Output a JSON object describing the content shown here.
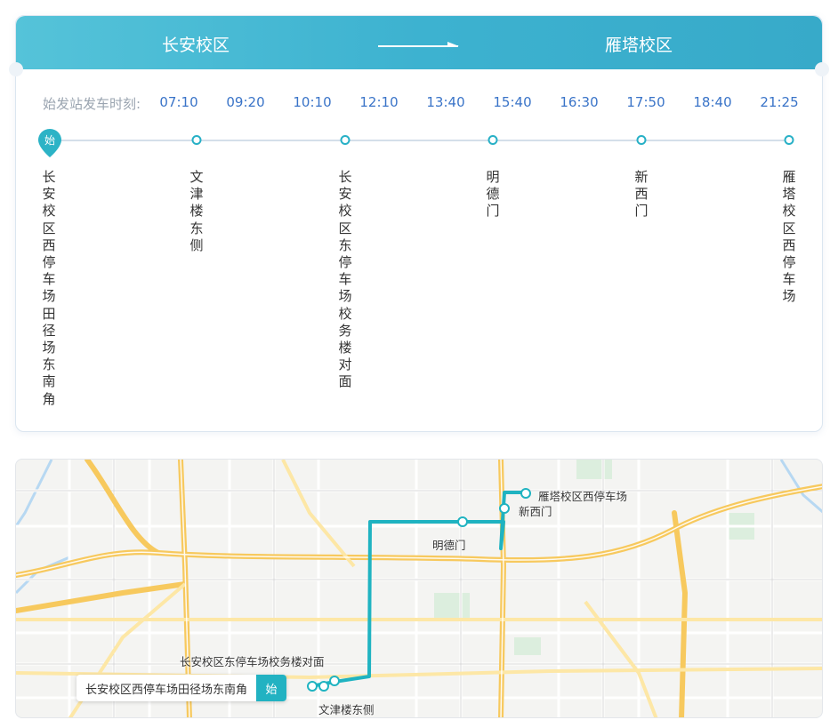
{
  "header": {
    "from_campus": "长安校区",
    "to_campus": "雁塔校区"
  },
  "schedule": {
    "label": "始发站发车时刻:",
    "times": [
      "07:10",
      "09:20",
      "10:10",
      "12:10",
      "13:40",
      "15:40",
      "16:30",
      "17:50",
      "18:40",
      "21:25"
    ]
  },
  "route": {
    "start_tag": "始",
    "stops": [
      "长安校区西停车场田径场东南角",
      "文津楼东侧",
      "长安校区东停车场校务楼对面",
      "明德门",
      "新西门",
      "雁塔校区西停车场"
    ]
  },
  "map": {
    "start_label": "长安校区西停车场田径场东南角",
    "start_tag": "始",
    "labels": {
      "east_parking": "长安校区东停车场校务楼对面",
      "wenjin": "文津楼东侧",
      "mingde": "明德门",
      "xinximen": "新西门",
      "yanta": "雁塔校区西停车场"
    }
  },
  "colors": {
    "accent": "#3db2d0",
    "time_blue": "#3a74c8",
    "route_teal": "#1fb3c1",
    "road_yellow": "#fbd97a"
  }
}
